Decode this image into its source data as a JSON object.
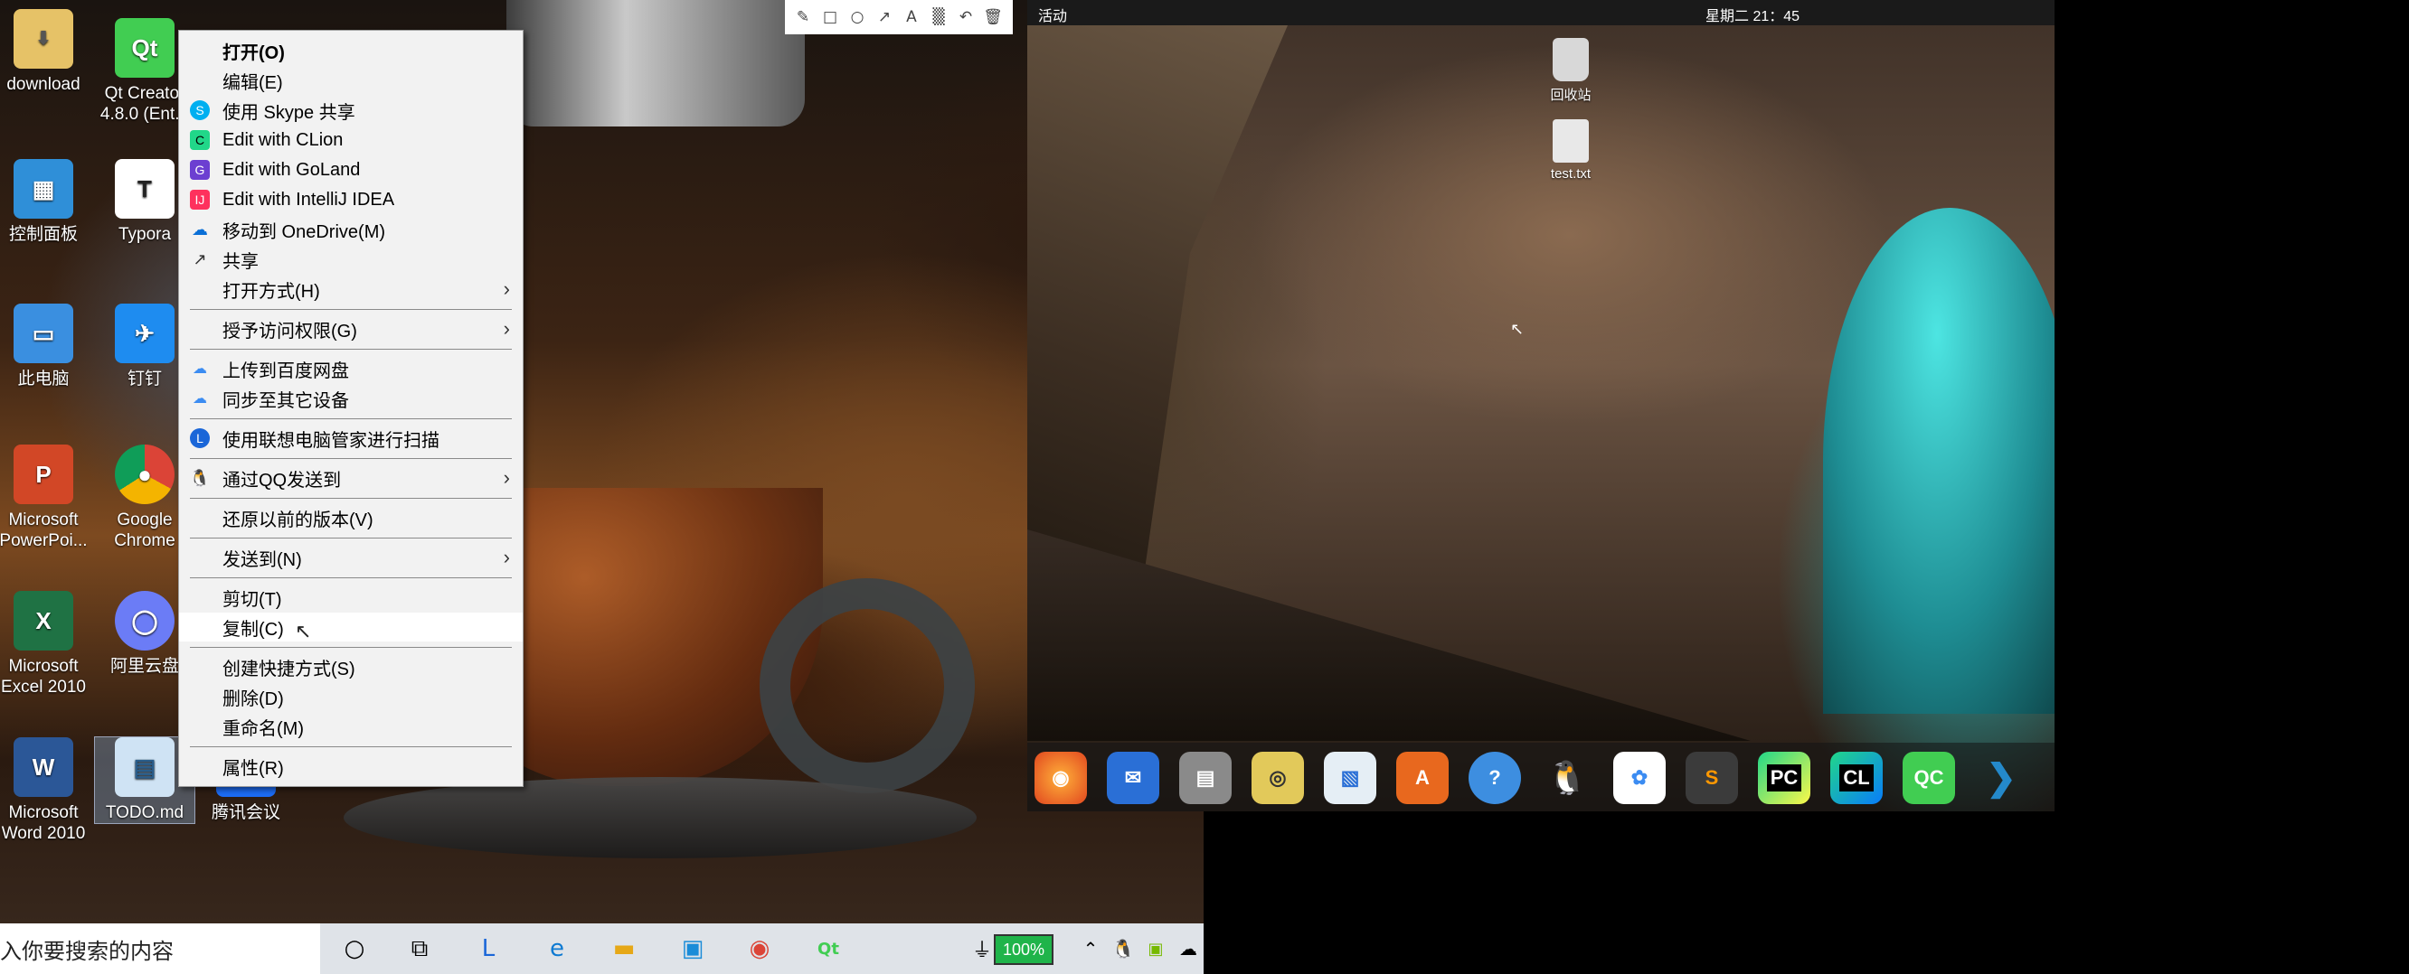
{
  "windows_desktop": {
    "icons": [
      {
        "name": "download",
        "label": "download"
      },
      {
        "name": "qt-creator",
        "label": "Qt Creator 4.8.0 (Ent..."
      },
      {
        "name": "control-panel",
        "label": "控制面板"
      },
      {
        "name": "typora",
        "label": "Typora"
      },
      {
        "name": "this-pc",
        "label": "此电脑"
      },
      {
        "name": "dingding",
        "label": "钉钉"
      },
      {
        "name": "powerpoint",
        "label": "Microsoft PowerPoi..."
      },
      {
        "name": "chrome",
        "label": "Google Chrome"
      },
      {
        "name": "excel",
        "label": "Microsoft Excel 2010"
      },
      {
        "name": "aliyun",
        "label": "阿里云盘"
      },
      {
        "name": "word",
        "label": "Microsoft Word 2010"
      },
      {
        "name": "todo",
        "label": "TODO.md"
      },
      {
        "name": "tencent-meeting",
        "label": "腾讯会议"
      }
    ]
  },
  "context_menu": {
    "items": [
      {
        "label": "打开(O)",
        "bold": true,
        "icon": ""
      },
      {
        "label": "编辑(E)",
        "icon": ""
      },
      {
        "label": "使用 Skype 共享",
        "icon": "skype-icon"
      },
      {
        "label": "Edit with CLion",
        "icon": "clion-icon"
      },
      {
        "label": "Edit with GoLand",
        "icon": "goland-icon"
      },
      {
        "label": "Edit with IntelliJ IDEA",
        "icon": "intellij-icon"
      },
      {
        "label": "移动到 OneDrive(M)",
        "icon": "onedrive-icon"
      },
      {
        "label": "共享",
        "icon": "share-icon"
      },
      {
        "label": "打开方式(H)",
        "icon": "",
        "submenu": true
      },
      {
        "label": "授予访问权限(G)",
        "icon": "",
        "submenu": true
      },
      {
        "label": "上传到百度网盘",
        "icon": "baidu-pan-icon"
      },
      {
        "label": "同步至其它设备",
        "icon": "baidu-pan-icon"
      },
      {
        "label": "使用联想电脑管家进行扫描",
        "icon": "lenovo-icon"
      },
      {
        "label": "通过QQ发送到",
        "icon": "qq-icon",
        "submenu": true
      },
      {
        "label": "还原以前的版本(V)",
        "icon": ""
      },
      {
        "label": "发送到(N)",
        "icon": "",
        "submenu": true
      },
      {
        "label": "剪切(T)",
        "icon": ""
      },
      {
        "label": "复制(C)",
        "icon": "",
        "highlighted": true
      },
      {
        "label": "创建快捷方式(S)",
        "icon": ""
      },
      {
        "label": "删除(D)",
        "icon": ""
      },
      {
        "label": "重命名(M)",
        "icon": ""
      },
      {
        "label": "属性(R)",
        "icon": ""
      }
    ]
  },
  "taskbar": {
    "search_placeholder": "入你要搜索的内容",
    "battery": "100%"
  },
  "ubuntu": {
    "activities": "活动",
    "clock": "星期二 21：45",
    "desktop_icons": [
      {
        "name": "trash",
        "label": "回收站"
      },
      {
        "name": "test-txt",
        "label": "test.txt"
      }
    ],
    "dock_apps": [
      "firefox",
      "thunderbird",
      "files",
      "rhythmbox",
      "image-viewer",
      "software",
      "help",
      "qq",
      "baidu-netdisk",
      "sublime-text",
      "pycharm",
      "clion",
      "qt-creator",
      "vscode"
    ],
    "dock_labels": {
      "pycharm": "PC",
      "clion": "CL",
      "qt": "QC"
    }
  },
  "colors": {
    "menu_bg": "#f2f2f2",
    "taskbar_bg": "#dfe3e8",
    "battery": "#1fb44a"
  }
}
